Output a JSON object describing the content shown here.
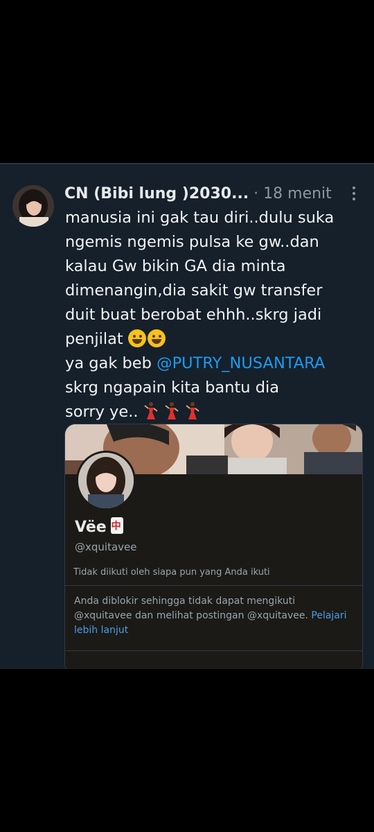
{
  "tweet": {
    "author_name": "CN (Bibi lung )2030...",
    "meta": " · 18 menit",
    "body_line1": "manusia ini gak tau diri..dulu suka\nngemis ngemis pulsa ke gw..dan\nkalau Gw bikin GA dia minta\ndimenangin,dia sakit gw transfer\nduit buat berobat ehhh..skrg jadi\npenjilat ",
    "body_line2_prefix": "ya gak beb ",
    "mention": "@PUTRY_NUSANTARA",
    "body_line3": "skrg ngapain kita bantu dia\nsorry ye.. ",
    "emojis": [
      "rolling-on-floor-laughing",
      "rolling-on-floor-laughing",
      "dancer",
      "dancer",
      "dancer"
    ]
  },
  "profile_card": {
    "name": "Vëe",
    "name_emoji": "mahjong-red-dragon",
    "handle": "@xquitavee",
    "follow_note": "Tidak diikuti oleh siapa pun yang Anda ikuti",
    "blocked_text": "Anda diblokir sehingga tidak dapat mengikuti @xquitavee dan melihat postingan @xquitavee. ",
    "learn_more": "Pelajari lebih lanjut"
  },
  "colors": {
    "background": "#000000",
    "panel": "#15202b",
    "card": "#1b1a17",
    "text": "#e7e9ea",
    "muted": "#8b98a5",
    "link": "#1d9bf0"
  }
}
